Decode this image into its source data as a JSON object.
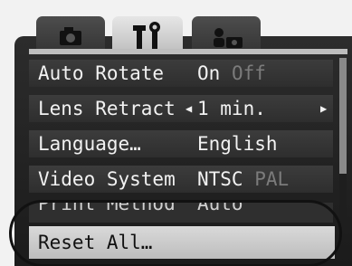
{
  "tabs": [
    {
      "name": "camera-tab",
      "icon": "camera-icon"
    },
    {
      "name": "setup-tab",
      "icon": "setup-tools-icon",
      "selected": true
    },
    {
      "name": "my-camera-tab",
      "icon": "my-camera-icon"
    }
  ],
  "menu": [
    {
      "label": "Auto Rotate",
      "value_active": "On",
      "value_inactive": "Off"
    },
    {
      "label": "Lens Retract",
      "value": "1 min."
    },
    {
      "label": "Language…",
      "value": "English"
    },
    {
      "label": "Video System",
      "value_active": "NTSC",
      "value_inactive": "PAL"
    },
    {
      "label": "Print Method",
      "value": "Auto"
    }
  ],
  "selected_item": {
    "label": "Reset All…"
  },
  "colors": {
    "panel": "#222222",
    "row": "#353535",
    "selected_tab": "#d9d9d9",
    "highlight": "#cfcfcf",
    "text": "#f2f2f2",
    "dim_text": "#7b7b7b"
  }
}
